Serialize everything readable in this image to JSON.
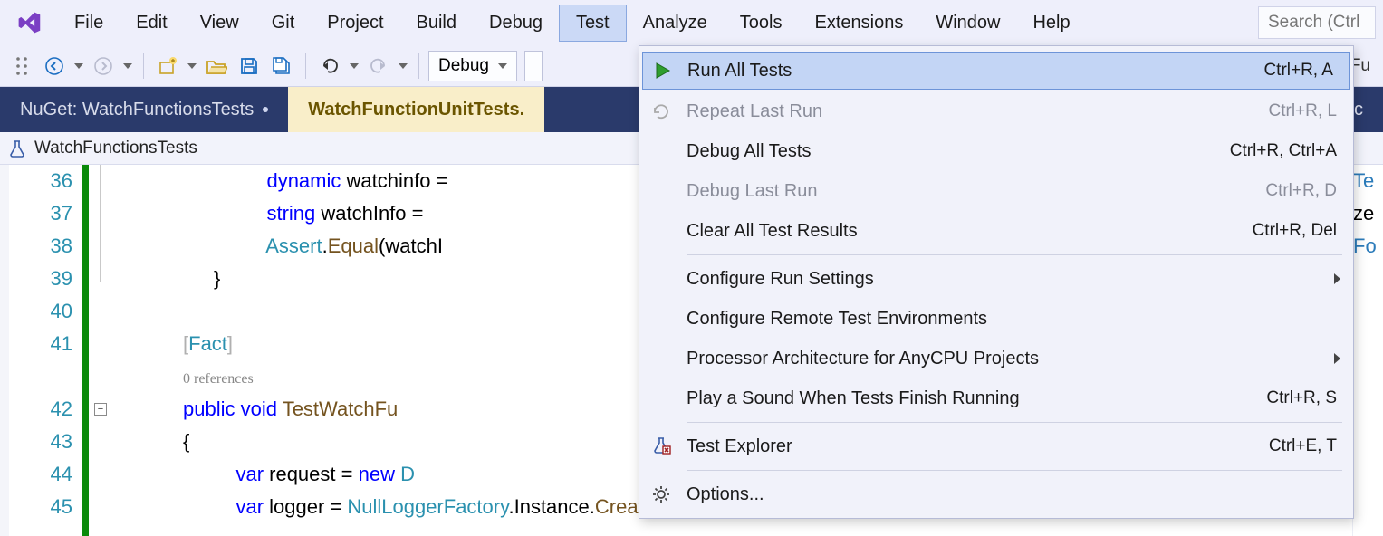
{
  "menubar": {
    "items": [
      "File",
      "Edit",
      "View",
      "Git",
      "Project",
      "Build",
      "Debug",
      "Test",
      "Analyze",
      "Tools",
      "Extensions",
      "Window",
      "Help"
    ],
    "active_index": 7,
    "search_placeholder": "Search (Ctrl"
  },
  "toolbar": {
    "config_dropdown": "Debug",
    "right_text": "lFu"
  },
  "doctabs": {
    "tabs": [
      {
        "label": "NuGet: WatchFunctionsTests",
        "active": false
      },
      {
        "label": "WatchFunctionUnitTests.",
        "active": true
      }
    ],
    "cutoff": "unc"
  },
  "breadcrumb": {
    "label": "WatchFunctionsTests"
  },
  "code": {
    "lines": [
      {
        "n": 36,
        "html": "    <span class='kw'>dynamic</span> watchinfo ="
      },
      {
        "n": 37,
        "html": "    <span class='kw'>string</span> watchInfo = "
      },
      {
        "n": 38,
        "html": "    <span class='type'>Assert</span>.<span class='method-name'>Equal</span>(watchI"
      },
      {
        "n": 39,
        "html": "}"
      },
      {
        "n": 40,
        "html": ""
      },
      {
        "n": 41,
        "html": "<span class='pale-bracket'>[</span><span class='type'>Fact</span><span class='pale-bracket'>]</span>"
      },
      {
        "n": -1,
        "html": "<span class='ref-hint'>0 references</span>"
      },
      {
        "n": 42,
        "html": "<span class='kw'>public</span> <span class='kw'>void</span> <span class='method-name'>TestWatchFu</span>"
      },
      {
        "n": 43,
        "html": "{"
      },
      {
        "n": 44,
        "html": "    <span class='kw'>var</span> request = <span class='kw'>new</span> <span class='type'>D</span>"
      },
      {
        "n": 45,
        "html": "    <span class='kw'>var</span> logger = <span class='type'>NullLoggerFactory</span>.Instance.<span class='method-name'>CreateLogger</span>(<span class='str'>\"Null Logger\"</span>);"
      }
    ],
    "right_peek": [
      "Te",
      "ze",
      "Fo",
      "",
      "",
      "",
      "",
      "",
      "",
      "",
      ""
    ]
  },
  "dropdown": {
    "items": [
      {
        "icon": "play-green-icon",
        "label": "Run All Tests",
        "shortcut": "Ctrl+R, A",
        "highlighted": true
      },
      {
        "icon": "repeat-icon",
        "label": "Repeat Last Run",
        "shortcut": "Ctrl+R, L",
        "disabled": true
      },
      {
        "icon": "",
        "label": "Debug All Tests",
        "shortcut": "Ctrl+R, Ctrl+A"
      },
      {
        "icon": "",
        "label": "Debug Last Run",
        "shortcut": "Ctrl+R, D",
        "disabled": true
      },
      {
        "icon": "",
        "label": "Clear All Test Results",
        "shortcut": "Ctrl+R, Del"
      },
      {
        "sep": true
      },
      {
        "icon": "",
        "label": "Configure Run Settings",
        "submenu": true
      },
      {
        "icon": "",
        "label": "Configure Remote Test Environments"
      },
      {
        "icon": "",
        "label": "Processor Architecture for AnyCPU Projects",
        "submenu": true
      },
      {
        "icon": "",
        "label": "Play a Sound When Tests Finish Running",
        "shortcut": "Ctrl+R, S"
      },
      {
        "sep": true
      },
      {
        "icon": "test-explorer-icon",
        "label": "Test Explorer",
        "shortcut": "Ctrl+E, T"
      },
      {
        "sep": true
      },
      {
        "icon": "gear-icon",
        "label": "Options..."
      }
    ]
  }
}
